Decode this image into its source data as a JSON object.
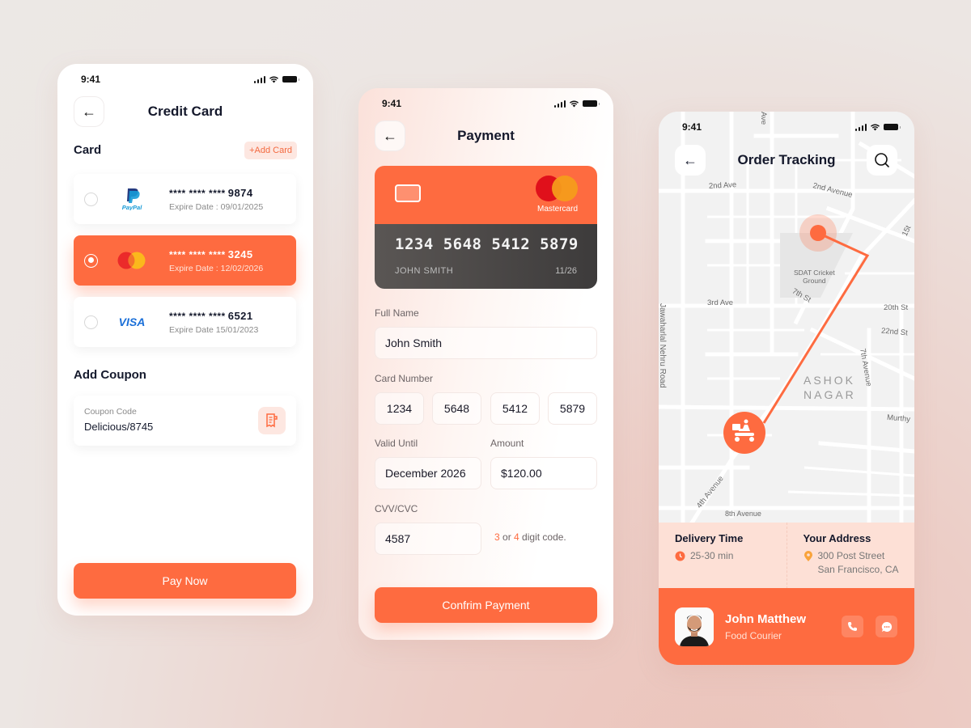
{
  "status_time": "9:41",
  "credit_card_screen": {
    "title": "Credit Card",
    "card_section": "Card",
    "add_card": "+Add Card",
    "cards": [
      {
        "brand": "PayPal",
        "masked": "**** **** ****",
        "last4": "9874",
        "expire_label": "Expire Date :",
        "expire": "09/01/2025",
        "selected": false
      },
      {
        "brand": "Mastercard",
        "masked": "**** **** ****",
        "last4": "3245",
        "expire_label": "Expire Date :",
        "expire": "12/02/2026",
        "selected": true
      },
      {
        "brand": "VISA",
        "masked": "**** **** ****",
        "last4": "6521",
        "expire_label": "Expire Date",
        "expire": "15/01/2023",
        "selected": false
      }
    ],
    "coupon_section": "Add Coupon",
    "coupon_label": "Coupon Code",
    "coupon_value": "Delicious/8745",
    "pay_button": "Pay Now"
  },
  "payment_screen": {
    "title": "Payment",
    "card": {
      "brand": "Mastercard",
      "number": "1234 5648 5412 5879",
      "holder": "JOHN SMITH",
      "expiry": "11/26"
    },
    "full_name_label": "Full Name",
    "full_name": "John Smith",
    "card_number_label": "Card Number",
    "card_number_parts": [
      "1234",
      "5648",
      "5412",
      "5879"
    ],
    "valid_until_label": "Valid Until",
    "valid_until": "December 2026",
    "amount_label": "Amount",
    "amount": "$120.00",
    "cvv_label": "CVV/CVC",
    "cvv": "4587",
    "hint": {
      "n1": "3",
      "or": " or ",
      "n2": "4",
      "rest": " digit code."
    },
    "confirm_button": "Confrim Payment"
  },
  "tracking_screen": {
    "title": "Order Tracking",
    "map_labels": {
      "ave_top": "Ave",
      "second_ave": "2nd Ave",
      "second_avenue": "2nd Avenue",
      "fifteenth": "15t",
      "ground": "SDAT Cricket",
      "ground2": "Ground",
      "seventh_st": "7th St",
      "third_ave": "3rd Ave",
      "twentieth": "20th St",
      "twentysecond": "22nd St",
      "jn_road": "Jawaharlal Nehru Road",
      "ashok": "ASHOK",
      "nagar": "NAGAR",
      "seventh_ave": "7th Avenue",
      "murthy": "Murthy",
      "fourth_ave": "4th Avenue",
      "eighth_ave": "8th Avenue"
    },
    "delivery_time_label": "Delivery Time",
    "delivery_time": "25-30 min",
    "address_label": "Your Address",
    "address_line1": "300 Post Street",
    "address_line2": "San Francisco, CA",
    "courier_name": "John Matthew",
    "courier_role": "Food Courier"
  },
  "colors": {
    "accent": "#fe6b40",
    "dark_card": "#454343",
    "accent_light": "#fde0d6"
  }
}
